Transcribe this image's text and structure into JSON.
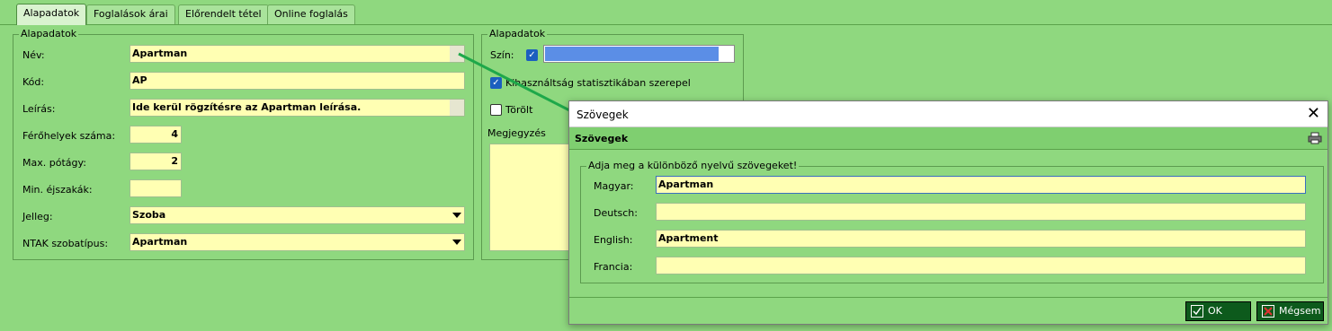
{
  "tabs": [
    {
      "label": "Alapadatok"
    },
    {
      "label": "Foglalások árai"
    },
    {
      "label": "Előrendelt tétel"
    },
    {
      "label": "Online foglalás"
    }
  ],
  "left_group": {
    "title": "Alapadatok",
    "fields": {
      "name_label": "Név:",
      "name_value": "Apartman",
      "code_label": "Kód:",
      "code_value": "AP",
      "desc_label": "Leírás:",
      "desc_value": "Ide kerül rögzítésre az Apartman leírása.",
      "seats_label": "Férőhelyek száma:",
      "seats_value": "4",
      "extra_bed_label": "Max. pótágy:",
      "extra_bed_value": "2",
      "min_nights_label": "Min. éjszakák:",
      "min_nights_value": "",
      "type_label": "Jelleg:",
      "type_value": "Szoba",
      "ntak_label": "NTAK szobatípus:",
      "ntak_value": "Apartman"
    }
  },
  "right_group": {
    "title": "Alapadatok",
    "color_label": "Szín:",
    "color_value": "#5b8ee6",
    "usage_stats_label": "Kihasználtság statisztikában szerepel",
    "deleted_label": "Törölt",
    "notes_title": "Megjegyzés"
  },
  "dialog": {
    "title": "Szövegek",
    "header": "Szövegek",
    "group_title": "Adja meg a különböző nyelvű szövegeket!",
    "rows": [
      {
        "label": "Magyar:",
        "value": "Apartman"
      },
      {
        "label": "Deutsch:",
        "value": ""
      },
      {
        "label": "English:",
        "value": "Apartment"
      },
      {
        "label": "Francia:",
        "value": ""
      }
    ],
    "ok_label": "OK",
    "cancel_label": "Mégsem"
  },
  "colors": {
    "background": "#8fd87f",
    "field": "#ffffb3",
    "button": "#0d5a1c",
    "connector": "#1ea84a"
  },
  "icons": [
    "close-icon",
    "printer-icon",
    "check-icon",
    "cancel-icon",
    "dropdown-arrow-icon"
  ]
}
